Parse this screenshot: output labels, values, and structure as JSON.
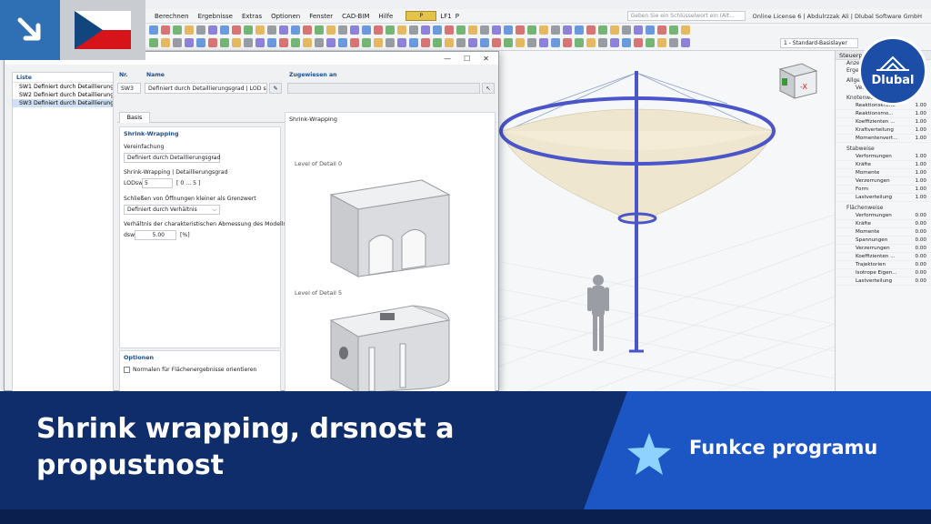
{
  "menubar": {
    "items": [
      "Berechnen",
      "Ergebnisse",
      "Extras",
      "Optionen",
      "Fenster",
      "CAD-BIM",
      "Hilfe"
    ],
    "lc_code": "P",
    "lc_name": "LF1",
    "lc_type": "P",
    "search_placeholder": "Geben Sie ein Schlüsselwort ein (Alt...",
    "license": "Online License 6 | Abdulrzzak Ali | Dlubal Software GmbH"
  },
  "toolbar": {
    "layer": "1 - Standard-Basislayer"
  },
  "dialog": {
    "list_header": "Liste",
    "list_items": [
      {
        "label": "SW1  Definiert durch Detaillierung",
        "color": "#b7d7ef"
      },
      {
        "label": "SW2  Definiert durch Detaillierung",
        "color": "#f0b400"
      },
      {
        "label": "SW3  Definiert durch Detaillierung",
        "color": "#1f4f9c"
      }
    ],
    "nr_label": "Nr.",
    "nr_value": "SW3",
    "name_label": "Name",
    "name_value": "Definiert durch Detaillierungsgrad | LOD sw : 5 |",
    "assigned_label": "Zugewiesen an",
    "tab_basis": "Basis",
    "pane_title": "Shrink-Wrapping",
    "simplification_label": "Vereinfachung",
    "simplification_value": "Definiert durch Detaillierungsgrad",
    "sw_lod_label": "Shrink-Wrapping | Detaillierungsgrad",
    "lod_label": "LODsw",
    "lod_value": "5",
    "lod_range": "[ 0 ... 5 ]",
    "close_openings_label": "Schließen von Öffnungen kleiner als Grenzwert",
    "close_openings_value": "Definiert durch Verhältnis",
    "ratio_label": "Verhältnis der charakteristischen Abmessung des Modells",
    "dsw_label": "dsw",
    "dsw_value": "5.00",
    "dsw_unit": "[%]",
    "preview_title": "Shrink-Wrapping",
    "lod0_label": "Level of Detail 0",
    "lod5_label": "Level of Detail 5",
    "options_title": "Optionen",
    "normals_label": "Normalen für Flächenergebnisse orientieren"
  },
  "rpanel": {
    "title": "Steuerpan",
    "sub1": "Anzeige",
    "sub2": "Ergebnis",
    "general": "Allgem",
    "general_sub": "Ver",
    "nodes_title": "Knotenweise",
    "nodes": [
      {
        "k": "Reaktionskräfte",
        "v": "1.00"
      },
      {
        "k": "Reaktionsmo...",
        "v": "1.00"
      },
      {
        "k": "Koeffizienten ...",
        "v": "1.00"
      },
      {
        "k": "Kraftverteilung",
        "v": "1.00"
      },
      {
        "k": "Momentenvert...",
        "v": "1.00"
      }
    ],
    "members_title": "Stabweise",
    "members": [
      {
        "k": "Verformungen",
        "v": "1.00"
      },
      {
        "k": "Kräfte",
        "v": "1.00"
      },
      {
        "k": "Momente",
        "v": "1.00"
      },
      {
        "k": "Verzerrungen",
        "v": "1.00"
      },
      {
        "k": "Form",
        "v": "1.00"
      },
      {
        "k": "Lastverteilung",
        "v": "1.00"
      }
    ],
    "surfaces_title": "Flächenweise",
    "surfaces": [
      {
        "k": "Verformungen",
        "v": "0.00"
      },
      {
        "k": "Kräfte",
        "v": "0.00"
      },
      {
        "k": "Momente",
        "v": "0.00"
      },
      {
        "k": "Spannungen",
        "v": "0.00"
      },
      {
        "k": "Verzerrungen",
        "v": "0.00"
      },
      {
        "k": "Koeffizienten ...",
        "v": "0.00"
      },
      {
        "k": "Trajektorien",
        "v": "0.00"
      },
      {
        "k": "Isotrope Eigen...",
        "v": "0.00"
      },
      {
        "k": "Lastverteilung",
        "v": "0.00"
      }
    ]
  },
  "banner": {
    "title": "Shrink wrapping, drsnost a propustnost",
    "feature": "Funkce programu"
  },
  "logo": {
    "text": "Dlubal"
  },
  "navcube": {
    "axis": "-X"
  },
  "colors": {
    "banner_dark": "#0f2c6b",
    "banner_accent": "#1c56c5",
    "corner_blue": "#2f6fb3",
    "brand": "#1d4ea7"
  }
}
